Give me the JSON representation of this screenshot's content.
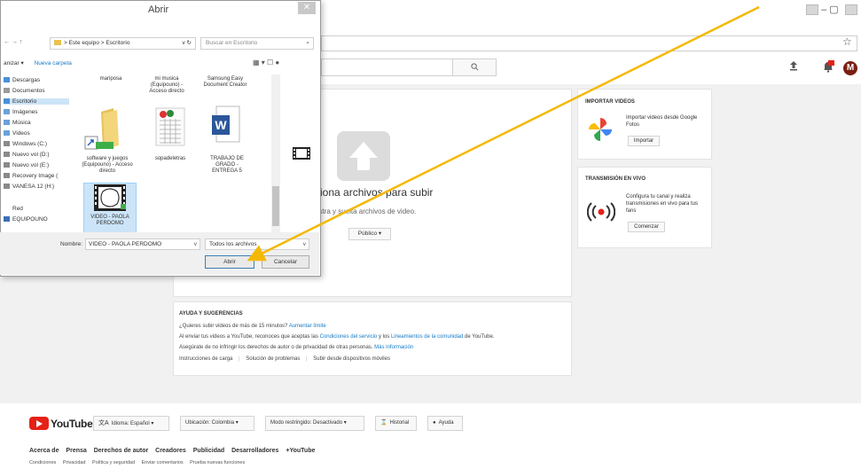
{
  "browser": {
    "window_controls": [
      "–",
      "▢",
      "✕"
    ],
    "star": "☆"
  },
  "youtube": {
    "search_icon": "search-icon",
    "header_icons": [
      "upload-icon",
      "notifications-icon"
    ],
    "avatar_letter": "M",
    "upload": {
      "title": "ciona archivos para subir",
      "subtitle": "astra y suelta archivos de video.",
      "privacy": "Público ▾"
    },
    "import_card": {
      "title": "IMPORTAR VIDEOS",
      "text": "Importar videos desde Google Fotos",
      "button": "Importar"
    },
    "live_card": {
      "title": "TRANSMISIÓN EN VIVO",
      "text": "Configura tu canal y realiza transmisiones en vivo para tus fans",
      "button": "Comenzar"
    },
    "help": {
      "title": "AYUDA Y SUGERENCIAS",
      "line1_prefix": "¿Quieres subir videos de más de 15 minutos?",
      "line1_link": "Aumentar límite",
      "line2_prefix": "Al enviar tus videos a YouTube, reconoces que aceptas las",
      "line2_link1": "Condiciones del servicio",
      "line2_mid": "y los",
      "line2_link2": "Lineamientos de la comunidad",
      "line2_suffix": "de YouTube.",
      "line3_prefix": "Asegúrate de no infringir los derechos de autor o de privacidad de otras personas.",
      "line3_link": "Más información",
      "links": [
        "Instrucciones de carga",
        "Solución de problemas",
        "Subir desde dispositivos móviles"
      ]
    },
    "footer": {
      "logo_text": "YouTube",
      "language": "Idioma: Español ▾",
      "location": "Ubicación: Colombia ▾",
      "restricted": "Modo restringido: Desactivado ▾",
      "history": "Historial",
      "help": "Ayuda",
      "links": [
        "Acerca de",
        "Prensa",
        "Derechos de autor",
        "Creadores",
        "Publicidad",
        "Desarrolladores",
        "+YouTube"
      ],
      "links2": [
        "Condiciones",
        "Privacidad",
        "Política y seguridad",
        "Enviar comentarios",
        "Prueba nuevas funciones"
      ]
    }
  },
  "dialog": {
    "title": "Abrir",
    "close": "✕",
    "nav": "← → ↑",
    "path": "> Este equipo > Escritorio",
    "refresh": "v  ↻",
    "search_placeholder": "Buscar en Escritorio",
    "organize": "anizar ▾",
    "new_folder": "Nueva carpeta",
    "view_buttons": "▦ ▾  ☐  ●",
    "tree": [
      {
        "label": "Descargas",
        "color": "#4a8fd8"
      },
      {
        "label": "Documentos",
        "color": "#9b9b9b"
      },
      {
        "label": "Escritorio",
        "color": "#4a8fd8"
      },
      {
        "label": "Imágenes",
        "color": "#6aa1d8"
      },
      {
        "label": "Música",
        "color": "#6aa1d8"
      },
      {
        "label": "Videos",
        "color": "#6aa1d8"
      },
      {
        "label": "Windows (C:)",
        "color": "#8a8a8a"
      },
      {
        "label": "Nuevo vol (D:)",
        "color": "#8a8a8a"
      },
      {
        "label": "Nuevo vol (E:)",
        "color": "#8a8a8a"
      },
      {
        "label": "Recovery Image (",
        "color": "#8a8a8a"
      },
      {
        "label": "VANESA 12 (H:)",
        "color": "#8a8a8a"
      },
      {
        "label": "Red",
        "color": "#ffffff"
      },
      {
        "label": "EQUIPOUNO",
        "color": "#3c6fb6"
      }
    ],
    "files": [
      {
        "label": "mariposa"
      },
      {
        "label": "mi musica (Equipouno) - Acceso directo"
      },
      {
        "label": "Samsung Easy Document Creator"
      },
      {
        "label": "software y juegos (Equipouno) - Acceso directo"
      },
      {
        "label": "sopadeletras"
      },
      {
        "label": "TRABAJO DE GRADO - ENTREGA 5"
      },
      {
        "label": "VIDEO - PAOLA PERDOMO"
      }
    ],
    "name_label": "Nombre:",
    "name_value": "VIDEO - PAOLA PERDOMO",
    "type_value": "Todos los archivos",
    "open_button": "Abrir",
    "cancel_button": "Cancelar"
  },
  "colors": {
    "arrow": "#f5b800",
    "youtube_red": "#e62117",
    "link": "#167ac6"
  }
}
